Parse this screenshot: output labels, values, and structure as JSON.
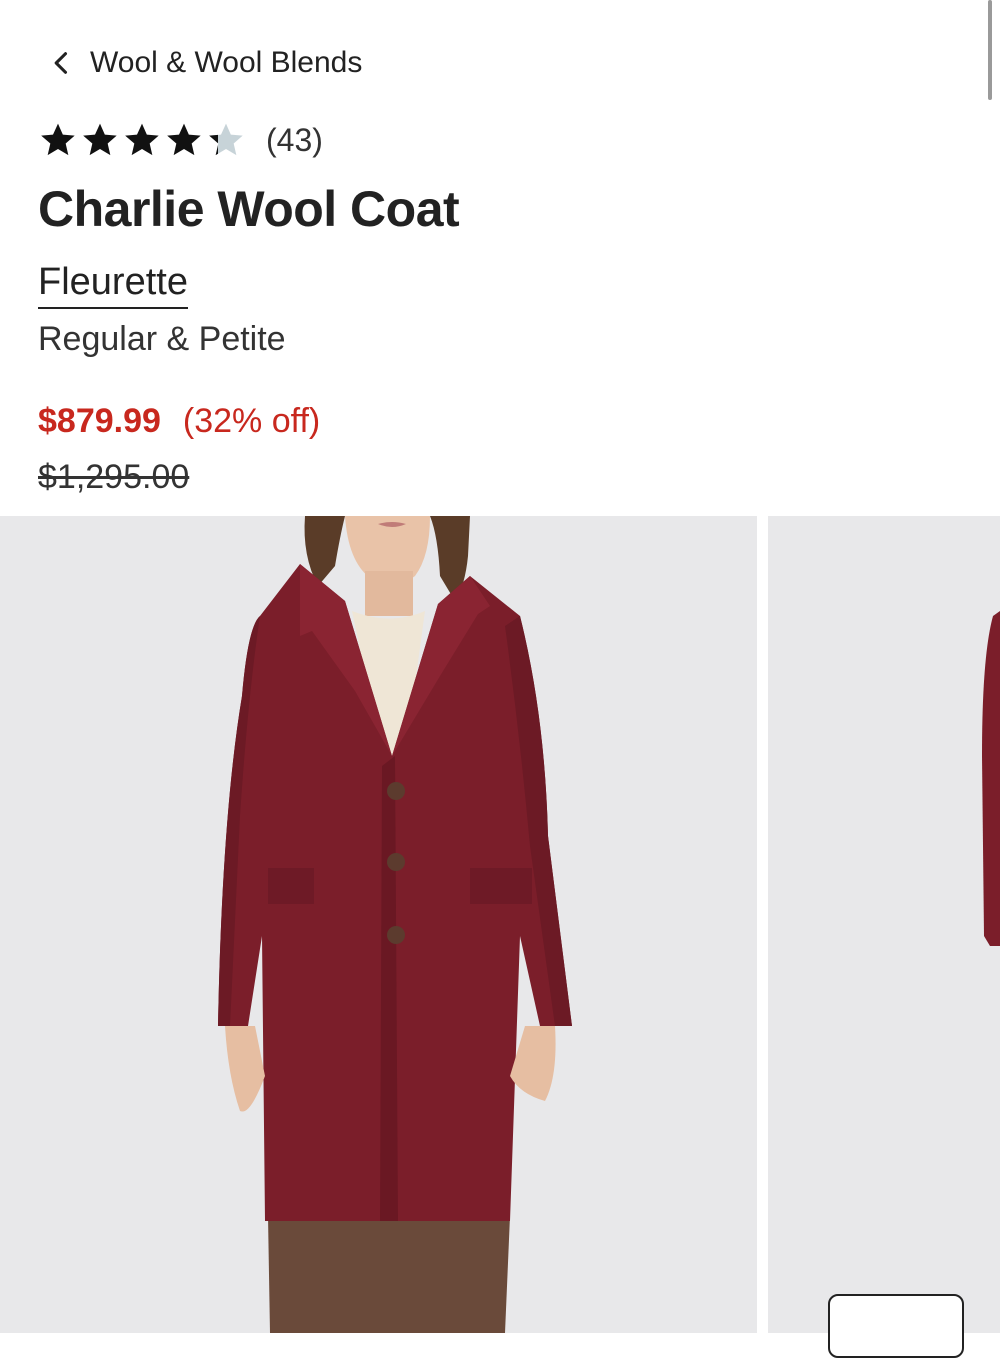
{
  "breadcrumb": {
    "label": "Wool & Wool Blends",
    "icon": "chevron-left-icon"
  },
  "rating": {
    "stars_value": 4.3,
    "stars_max": 5,
    "count": "(43)"
  },
  "product": {
    "title": "Charlie Wool Coat",
    "brand": "Fleurette",
    "fit": "Regular & Petite"
  },
  "pricing": {
    "sale_price": "$879.99",
    "discount": "(32% off)",
    "original_price": "$1,295.00"
  },
  "colors": {
    "sale": "#c8281e",
    "star_filled": "#111111",
    "star_empty": "#c7d3d8",
    "coat": "#7b1e2a",
    "photo_bg": "#e8e8ea"
  }
}
